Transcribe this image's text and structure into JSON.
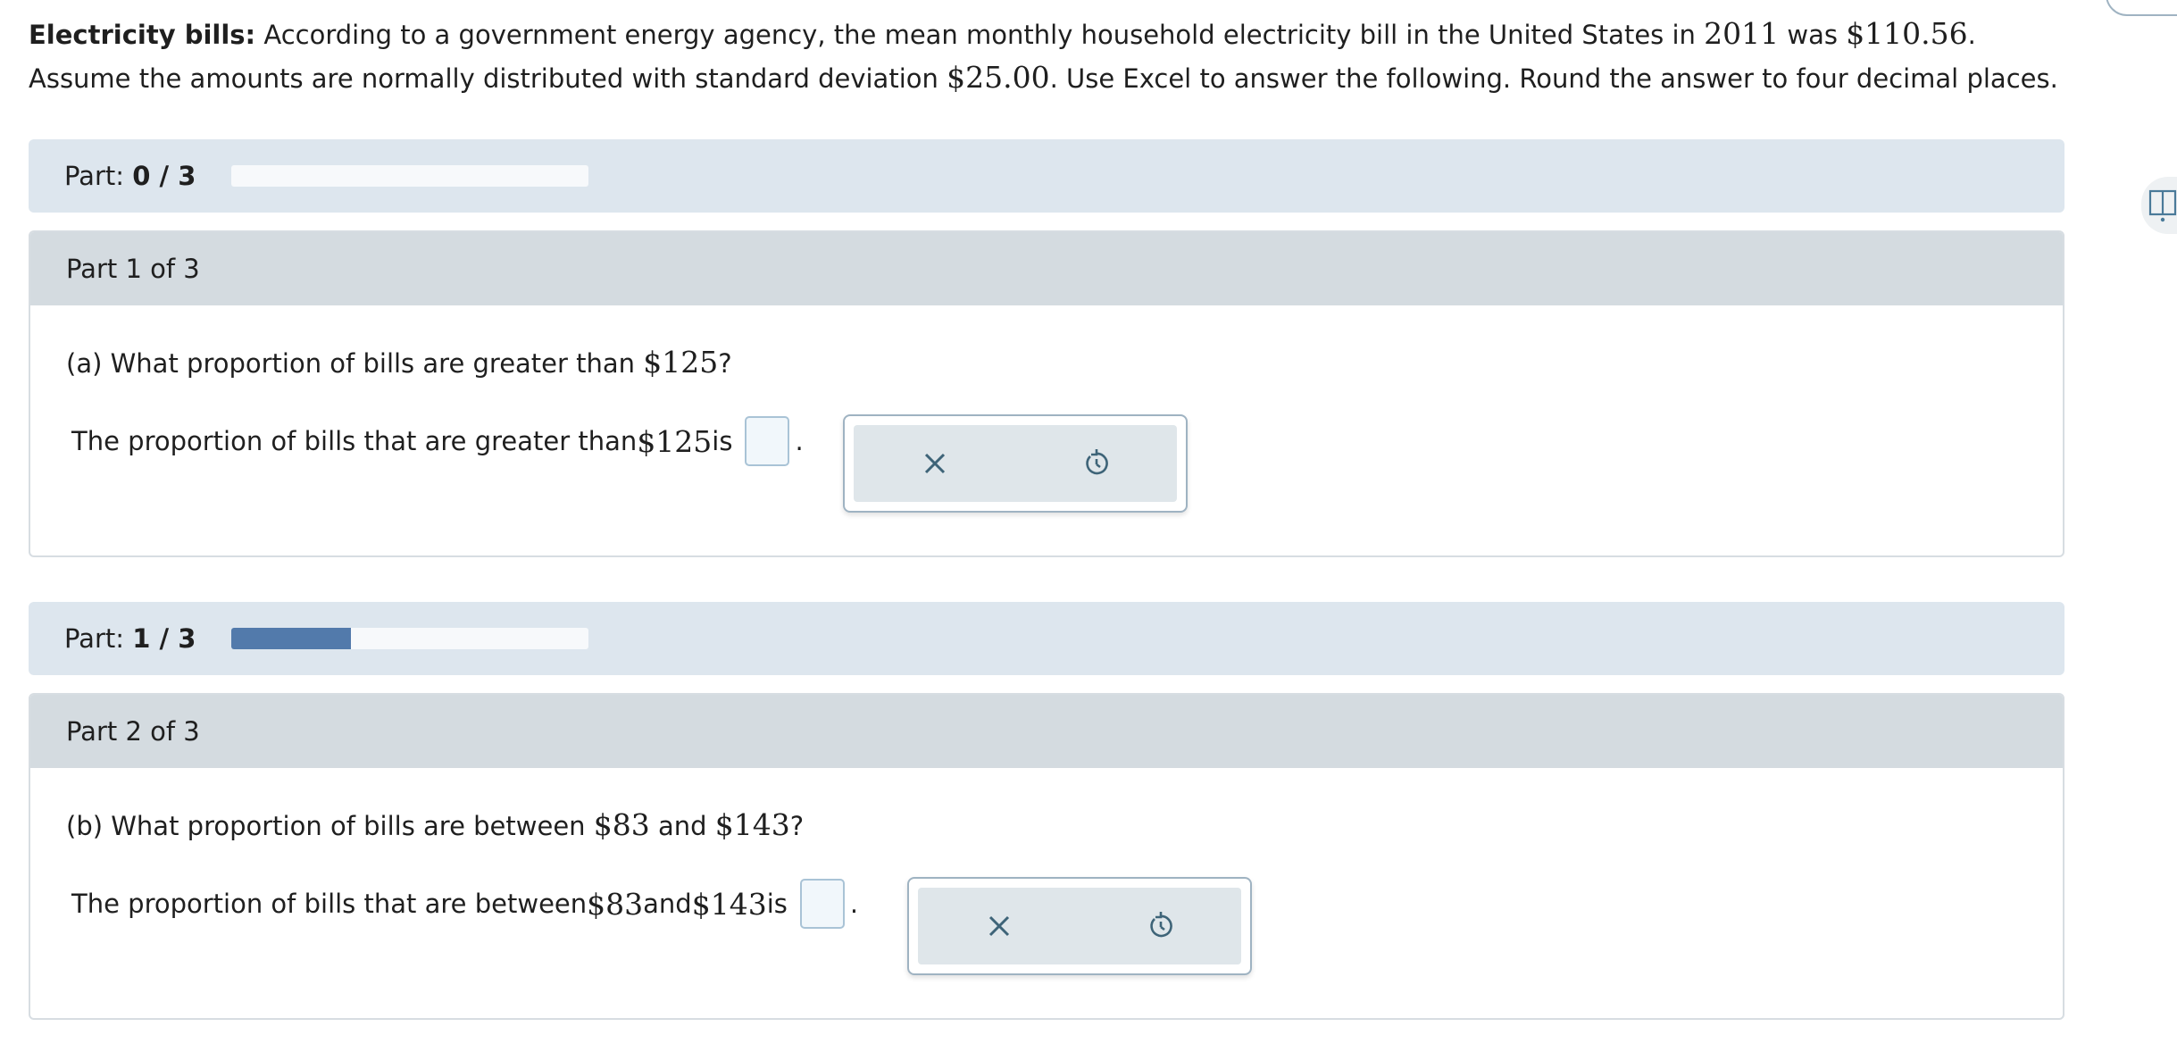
{
  "intro": {
    "lead": "Electricity bills:",
    "t1": " According to a government energy agency, the mean monthly household electricity bill in the United States in ",
    "year": "2011",
    "t2": " was ",
    "mean": "$110.56",
    "t3": ". Assume the amounts are normally distributed with standard deviation ",
    "sd": "$25.00",
    "t4": ". Use Excel to answer the following. Round the answer to four decimal places."
  },
  "progress": [
    {
      "label": "Part:",
      "value": "0 / 3",
      "fraction": 0.0
    },
    {
      "label": "Part:",
      "value": "1 / 3",
      "fraction": 0.3333
    }
  ],
  "parts": [
    {
      "title": "Part 1 of 3",
      "question": {
        "pre": "(a) What proportion of bills are greater than ",
        "amt1": "$125",
        "post": "?"
      },
      "answer": {
        "pre": "The proportion of bills that are greater than ",
        "amt1": "$125",
        "post": " is",
        "value": "",
        "period": "."
      }
    },
    {
      "title": "Part 2 of 3",
      "question": {
        "pre": "(b) What proportion of bills are between ",
        "amt1": "$83",
        "mid": " and ",
        "amt2": "$143",
        "post": "?"
      },
      "answer": {
        "pre": "The proportion of bills that are between ",
        "amt1": "$83",
        "mid": " and ",
        "amt2": "$143",
        "post": " is",
        "value": "",
        "period": "."
      }
    }
  ],
  "icons": {
    "clear": "close-icon",
    "reset": "undo-icon",
    "sidebar": "book-icon"
  },
  "colors": {
    "progress_fill": "#527aab",
    "progress_bg": "#dde6ee",
    "part_header": "#d4dbe0"
  }
}
